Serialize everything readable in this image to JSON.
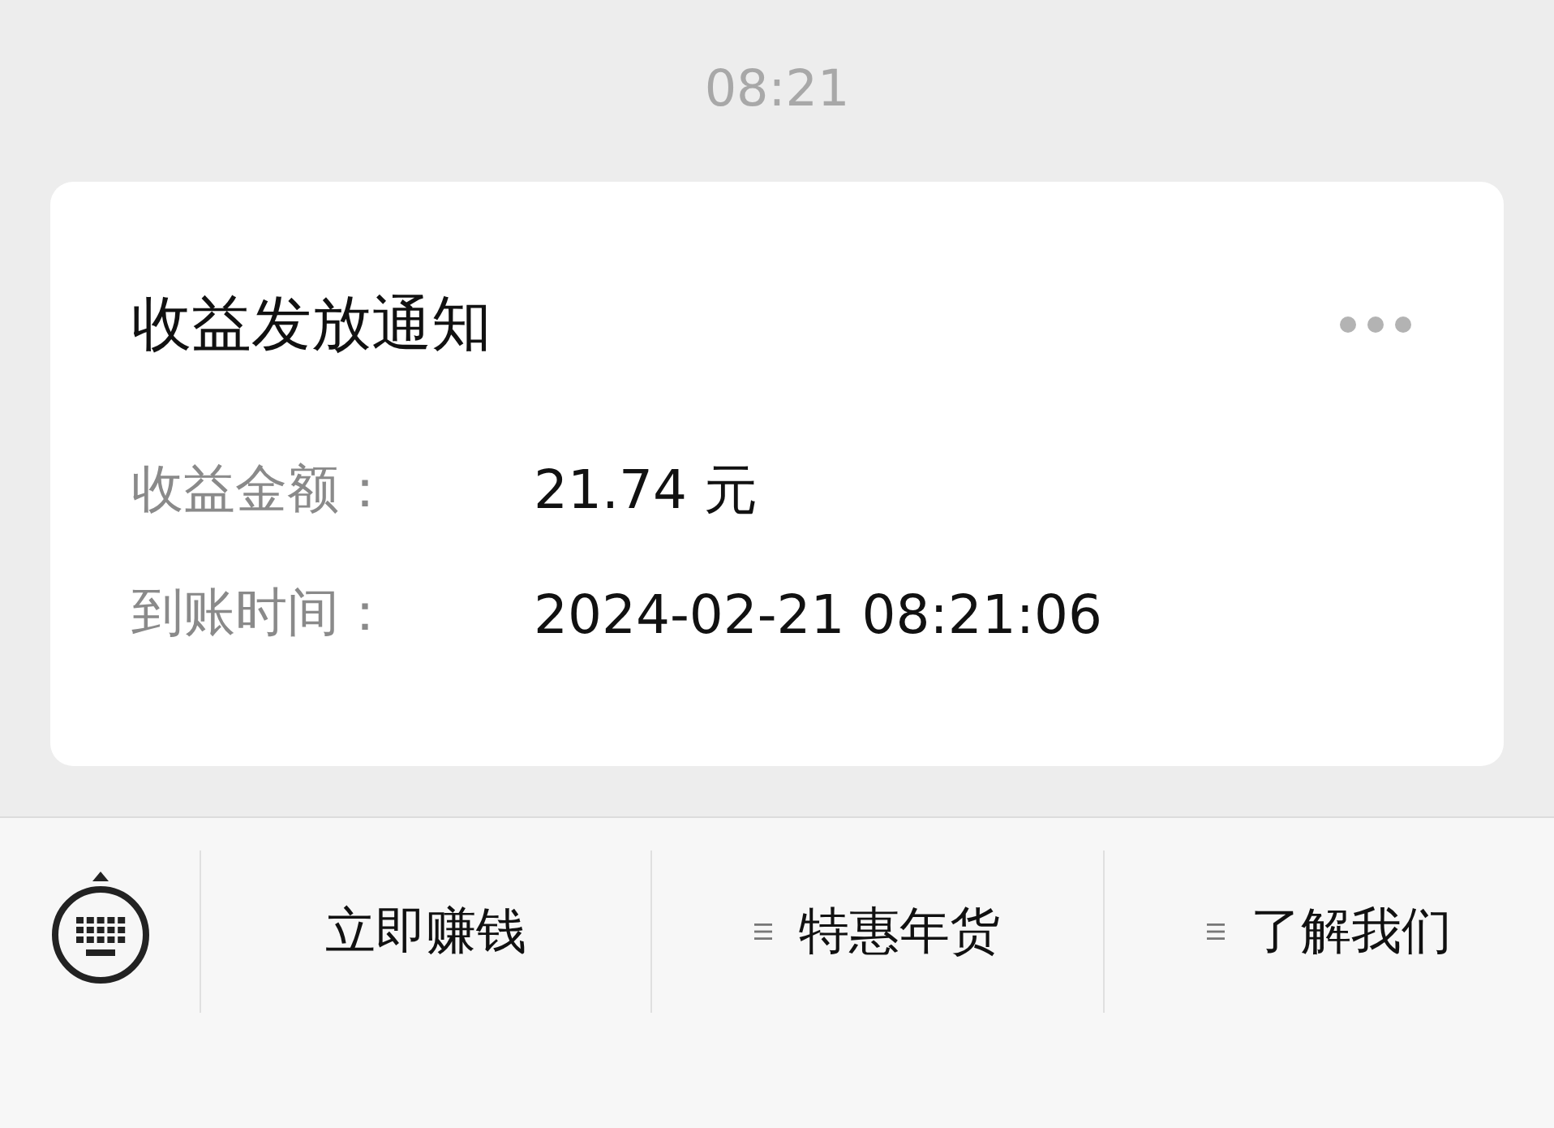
{
  "time": "08:21",
  "card": {
    "title": "收益发放通知",
    "fields": [
      {
        "label": "收益金额：",
        "value": "21.74 元"
      },
      {
        "label": "到账时间：",
        "value": "2024-02-21 08:21:06"
      }
    ]
  },
  "menu": [
    {
      "label": "立即赚钱",
      "has_submenu": false
    },
    {
      "label": "特惠年货",
      "has_submenu": true
    },
    {
      "label": "了解我们",
      "has_submenu": true
    }
  ]
}
